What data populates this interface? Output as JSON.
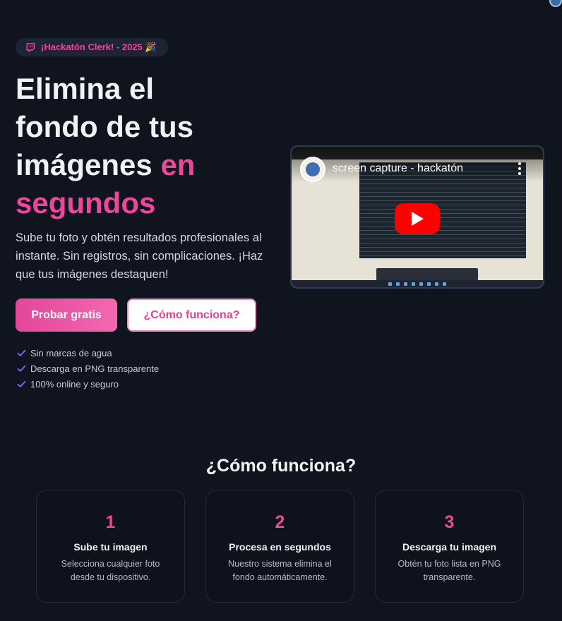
{
  "badge": {
    "icon": "twitch-icon",
    "text": "¡Hackatón Clerk! - 2025 🎉"
  },
  "hero": {
    "title_line1": "Elimina el",
    "title_line2": "fondo de tus",
    "title_line3": "imágenes ",
    "title_accent1": "en",
    "title_accent2": "segundos",
    "subtitle": "Sube tu foto y obtén resultados profesionales al instante. Sin registros, sin complicaciones. ¡Haz que tus imágenes destaquen!",
    "accent_color": "#ec4899"
  },
  "buttons": {
    "primary_label": "Probar gratis",
    "secondary_label": "¿Cómo funciona?"
  },
  "features": [
    "Sin marcas de agua",
    "Descarga en PNG transparente",
    "100% online y seguro"
  ],
  "video": {
    "title": "screen capture - hackatón",
    "play_icon": "youtube-play-icon",
    "menu_icon": "more-vert-icon"
  },
  "how_it_works": {
    "title": "¿Cómo funciona?",
    "steps": [
      {
        "number": "1",
        "title": "Sube tu imagen",
        "description": "Selecciona cualquier foto desde tu dispositivo."
      },
      {
        "number": "2",
        "title": "Procesa en segundos",
        "description": "Nuestro sistema elimina el fondo automáticamente."
      },
      {
        "number": "3",
        "title": "Descarga tu imagen",
        "description": "Obtén tu foto lista en PNG transparente."
      }
    ]
  }
}
